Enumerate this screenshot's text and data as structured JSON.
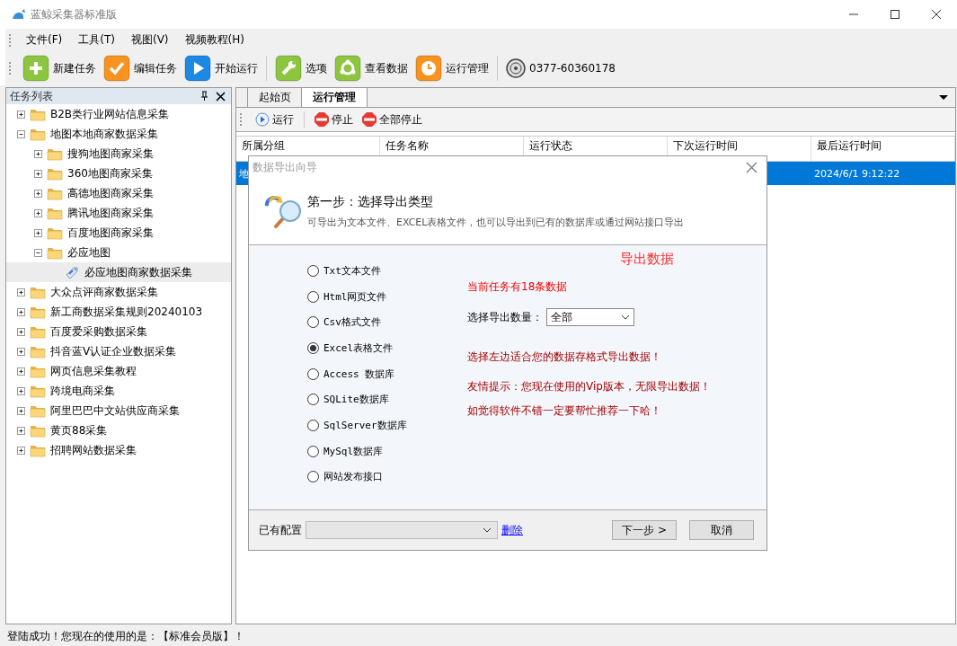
{
  "window": {
    "title": "蓝鲸采集器标准版"
  },
  "menu": [
    "文件(F)",
    "工具(T)",
    "视图(V)",
    "视频教程(H)"
  ],
  "toolbar": [
    {
      "kind": "new",
      "label": "新建任务"
    },
    {
      "kind": "edit",
      "label": "编辑任务"
    },
    {
      "kind": "start",
      "label": "开始运行"
    },
    {
      "kind": "options",
      "label": "选项"
    },
    {
      "kind": "data",
      "label": "查看数据"
    },
    {
      "kind": "manage",
      "label": "运行管理"
    },
    {
      "kind": "phone",
      "label": "0377-60360178"
    }
  ],
  "task_panel": {
    "title": "任务列表",
    "tree": [
      {
        "kind": "folder",
        "label": "B2B类行业网站信息采集",
        "expanded": false,
        "selected": false
      },
      {
        "kind": "folder",
        "label": "地图本地商家数据采集",
        "expanded": true,
        "selected": false,
        "children": [
          {
            "kind": "folder",
            "label": "搜狗地图商家采集",
            "expanded": false,
            "selected": false
          },
          {
            "kind": "folder",
            "label": "360地图商家采集",
            "expanded": false,
            "selected": false
          },
          {
            "kind": "folder",
            "label": "高德地图商家采集",
            "expanded": false,
            "selected": false
          },
          {
            "kind": "folder",
            "label": "腾讯地图商家采集",
            "expanded": false,
            "selected": false
          },
          {
            "kind": "folder",
            "label": "百度地图商家采集",
            "expanded": false,
            "selected": false
          },
          {
            "kind": "folder",
            "label": "必应地图",
            "expanded": true,
            "selected": false,
            "children": [
              {
                "kind": "task",
                "label": "必应地图商家数据采集",
                "selected": true
              }
            ]
          }
        ]
      },
      {
        "kind": "folder",
        "label": "大众点评商家数据采集",
        "expanded": false,
        "selected": false
      },
      {
        "kind": "folder",
        "label": "新工商数据采集规则20240103",
        "expanded": false,
        "selected": false
      },
      {
        "kind": "folder",
        "label": "百度爱采购数据采集",
        "expanded": false,
        "selected": false
      },
      {
        "kind": "folder",
        "label": "抖音蓝V认证企业数据采集",
        "expanded": false,
        "selected": false
      },
      {
        "kind": "folder",
        "label": "网页信息采集教程",
        "expanded": false,
        "selected": false
      },
      {
        "kind": "folder",
        "label": "跨境电商采集",
        "expanded": false,
        "selected": false
      },
      {
        "kind": "folder",
        "label": "阿里巴巴中文站供应商采集",
        "expanded": false,
        "selected": false
      },
      {
        "kind": "folder",
        "label": "黄页88采集",
        "expanded": false,
        "selected": false
      },
      {
        "kind": "folder",
        "label": "招聘网站数据采集",
        "expanded": false,
        "selected": false
      }
    ]
  },
  "tabs": [
    {
      "label": "起始页",
      "selected": false
    },
    {
      "label": "运行管理",
      "selected": true
    }
  ],
  "run_toolbar": [
    {
      "kind": "run",
      "label": "运行"
    },
    {
      "kind": "stop",
      "label": "停止"
    },
    {
      "kind": "stop",
      "label": "全部停止"
    }
  ],
  "table": {
    "columns": [
      "所属分组",
      "任务名称",
      "运行状态",
      "下次运行时间",
      "最后运行时间"
    ],
    "rows": [
      {
        "group": "地",
        "last_run": "2024/6/1 9:12:22",
        "selected": true
      }
    ]
  },
  "dialog": {
    "title": "数据导出向导",
    "heading": "第一步：选择导出类型",
    "subtitle": "可导出为文本文件、EXCEL表格文件，也可以导出到已有的数据库或通过网站接口导出",
    "options": [
      {
        "label": "Txt文本文件",
        "selected": false
      },
      {
        "label": "Html网页文件",
        "selected": false
      },
      {
        "label": "Csv格式文件",
        "selected": false
      },
      {
        "label": "Excel表格文件",
        "selected": true
      },
      {
        "label": "Access 数据库",
        "selected": false
      },
      {
        "label": "SQLite数据库",
        "selected": false
      },
      {
        "label": "SqlServer数据库",
        "selected": false
      },
      {
        "label": "MySql数据库",
        "selected": false
      },
      {
        "label": "网站发布接口",
        "selected": false
      }
    ],
    "export_title": "导出数据",
    "record_count": "当前任务有18条数据",
    "quantity": {
      "label": "选择导出数量：",
      "value": "全部"
    },
    "hints": [
      "选择左边适合您的数据存格式导出数据！",
      "友情提示：您现在使用的Vip版本，无限导出数据！",
      "如觉得软件不错一定要帮忙推荐一下哈！"
    ],
    "config_label": "已有配置",
    "delete_link": "删除",
    "buttons": [
      "下一步 >",
      "取消"
    ]
  },
  "status_bar": "登陆成功！您现在的使用的是：【标准会员版】！"
}
